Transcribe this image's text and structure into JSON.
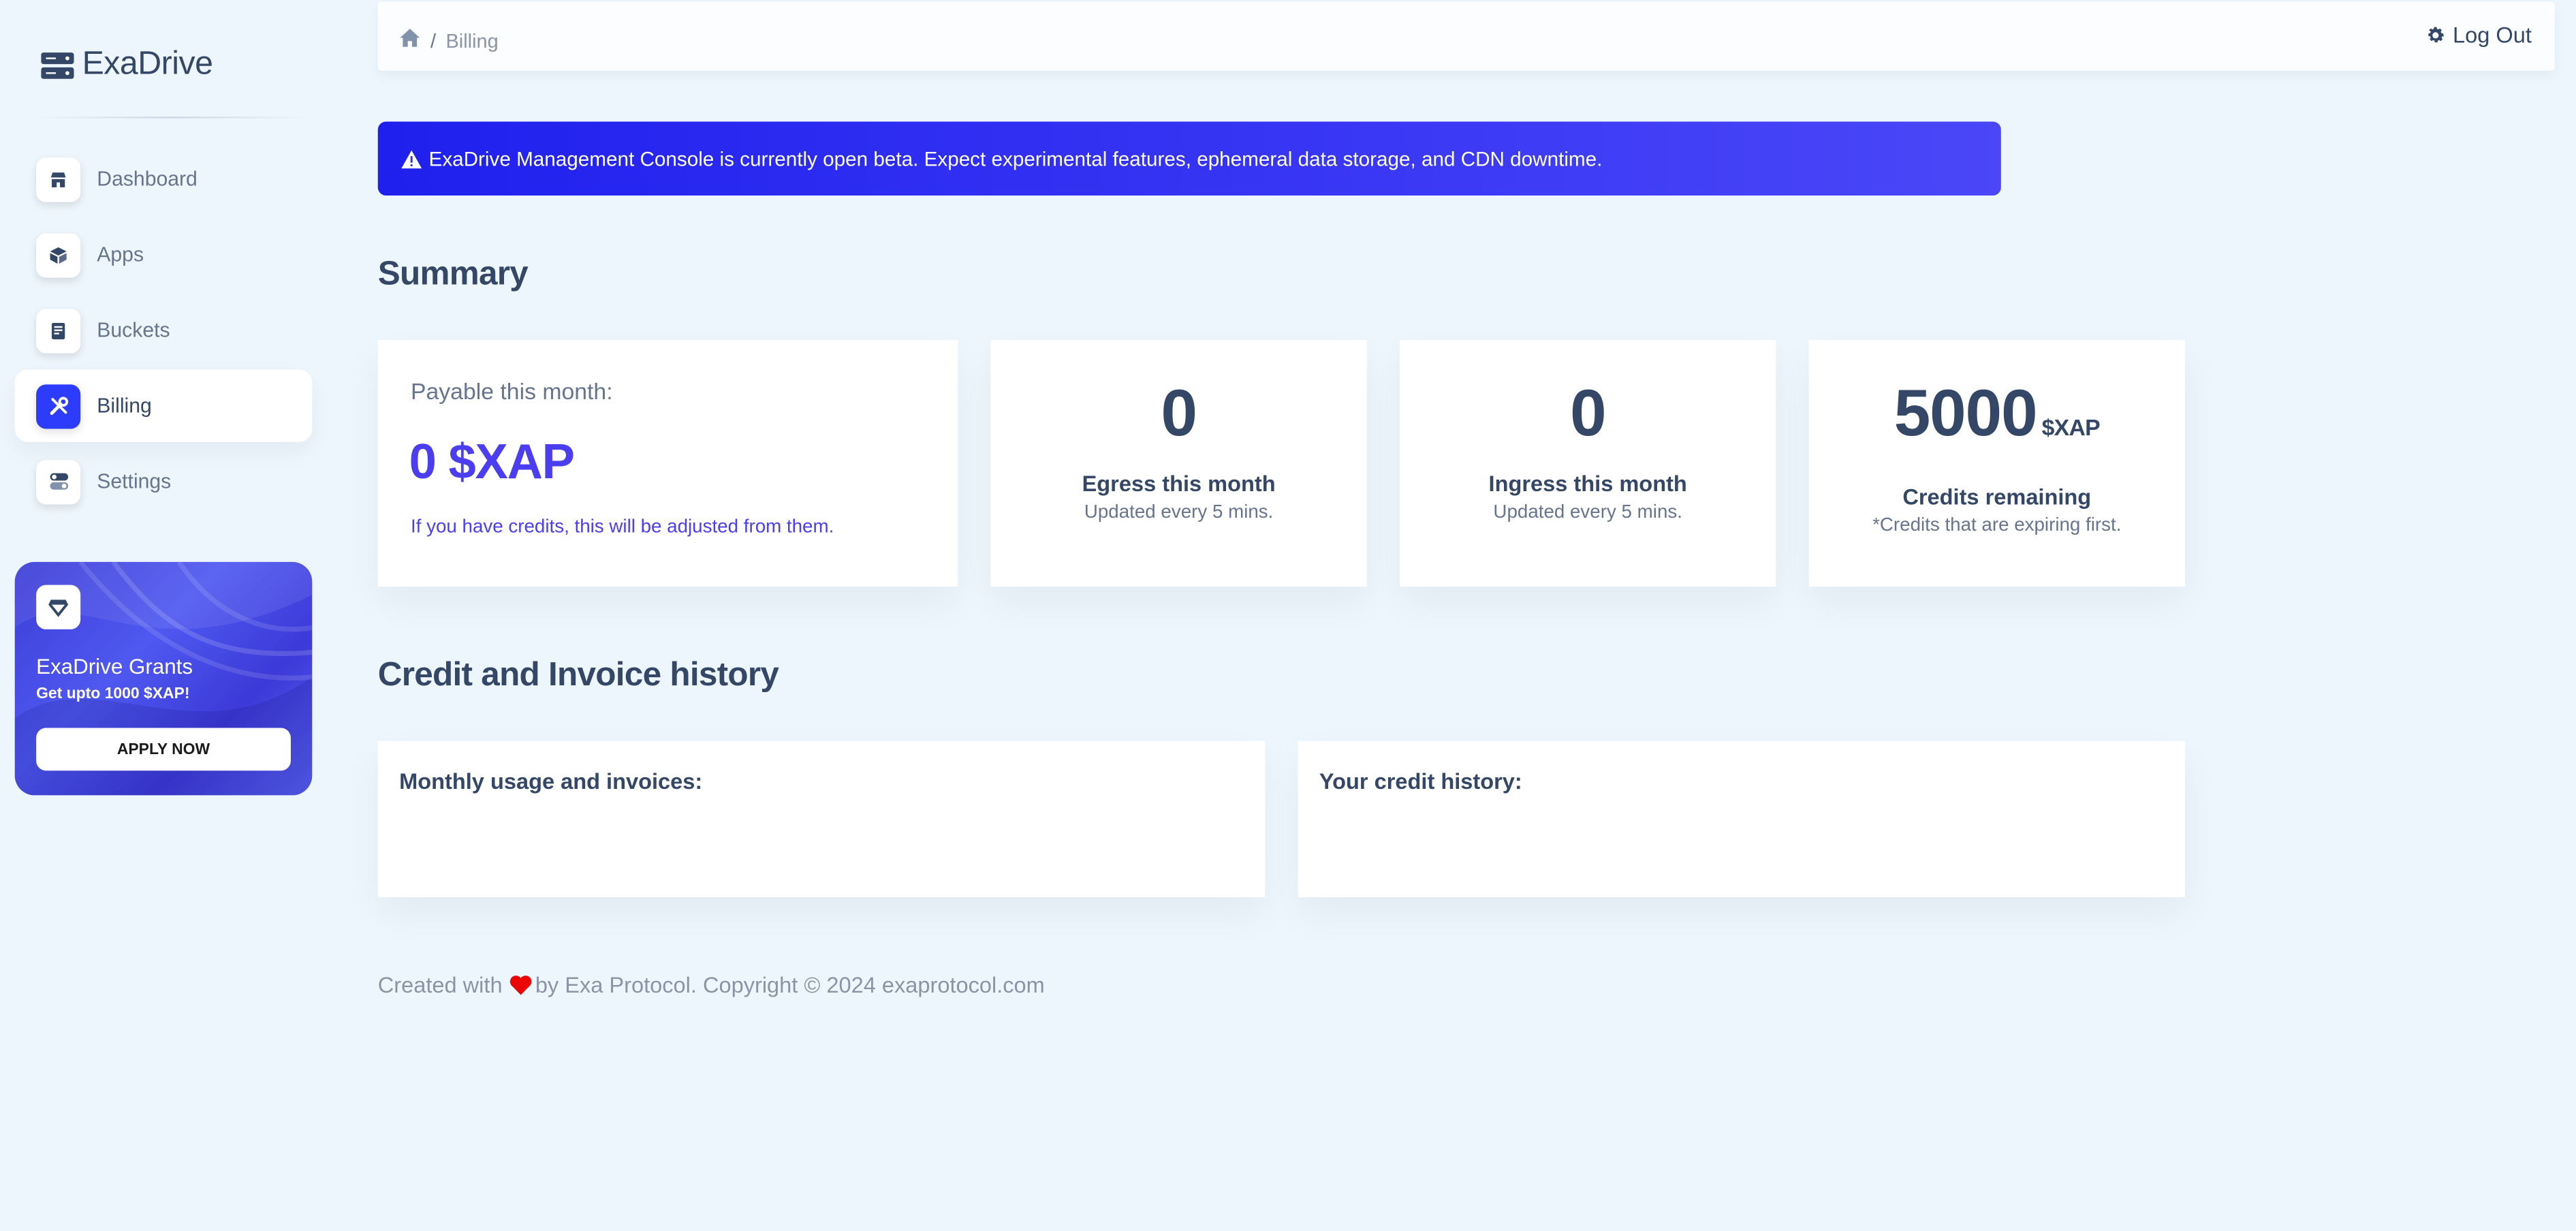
{
  "app": {
    "brand": "ExaDrive"
  },
  "sidebar": {
    "items": [
      {
        "label": "Dashboard",
        "icon": "shop-icon",
        "active": false
      },
      {
        "label": "Apps",
        "icon": "box-icon",
        "active": false
      },
      {
        "label": "Buckets",
        "icon": "document-icon",
        "active": false
      },
      {
        "label": "Billing",
        "icon": "tools-icon",
        "active": true
      },
      {
        "label": "Settings",
        "icon": "toggle-icon",
        "active": false
      }
    ],
    "grant": {
      "title": "ExaDrive Grants",
      "subtitle": "Get upto 1000 $XAP!",
      "button": "APPLY NOW",
      "icon": "diamond-icon"
    }
  },
  "header": {
    "breadcrumb_current": "Billing",
    "breadcrumb_sep": "/",
    "logout_label": "Log Out"
  },
  "alert": {
    "text": "ExaDrive Management Console is currently open beta. Expect experimental features, ephemeral data storage, and CDN downtime."
  },
  "summary": {
    "heading": "Summary",
    "payable": {
      "label": "Payable this month:",
      "value": "0 $XAP",
      "note": "If you have credits, this will be adjusted from them."
    },
    "egress": {
      "value": "0",
      "label": "Egress this month",
      "sub": "Updated every 5 mins."
    },
    "ingress": {
      "value": "0",
      "label": "Ingress this month",
      "sub": "Updated every 5 mins."
    },
    "credits": {
      "value": "5000",
      "unit": "$XAP",
      "label": "Credits remaining",
      "sub": "*Credits that are expiring first."
    }
  },
  "history": {
    "heading": "Credit and Invoice history",
    "invoices_title": "Monthly usage and invoices:",
    "credits_title": "Your credit history:"
  },
  "footer": {
    "before": "Created with",
    "after": "by Exa Protocol. Copyright © 2024 exaprotocol.com"
  },
  "colors": {
    "accent": "#2d3cfb",
    "payable": "#4a3ef0",
    "heart": "#ea0606"
  }
}
